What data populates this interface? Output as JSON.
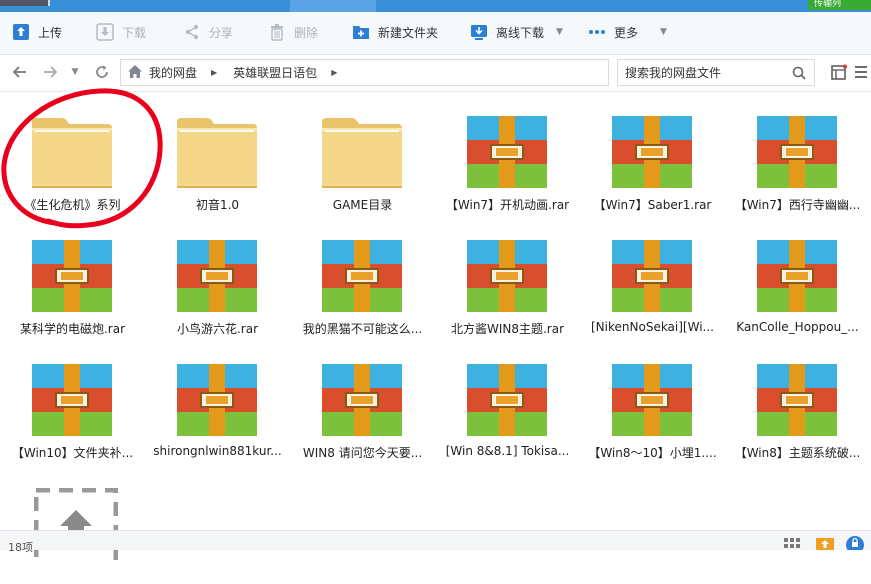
{
  "window": {
    "top_right_badge": "传输列"
  },
  "toolbar": {
    "upload": "上传",
    "download": "下载",
    "share": "分享",
    "delete": "删除",
    "new_folder": "新建文件夹",
    "offline_download": "离线下载",
    "more": "更多"
  },
  "nav": {
    "crumbs": [
      "我的网盘",
      "英雄联盟日语包"
    ],
    "search_placeholder": "搜索我的网盘文件"
  },
  "files": [
    {
      "name": "《生化危机》系列",
      "type": "folder"
    },
    {
      "name": "初音1.0",
      "type": "folder"
    },
    {
      "name": "GAME目录",
      "type": "folder"
    },
    {
      "name": "【Win7】开机动画.rar",
      "type": "rar"
    },
    {
      "name": "【Win7】Saber1.rar",
      "type": "rar"
    },
    {
      "name": "【Win7】西行寺幽幽...",
      "type": "rar"
    },
    {
      "name": "某科学的电磁炮.rar",
      "type": "rar"
    },
    {
      "name": "小鸟游六花.rar",
      "type": "rar"
    },
    {
      "name": "我的黑猫不可能这么...",
      "type": "rar"
    },
    {
      "name": "北方酱WIN8主题.rar",
      "type": "rar"
    },
    {
      "name": "[NikenNoSekai][Wi...",
      "type": "rar"
    },
    {
      "name": "KanColle_Hoppou_...",
      "type": "rar"
    },
    {
      "name": "【Win10】文件夹补...",
      "type": "rar"
    },
    {
      "name": "shirongnlwin881kur...",
      "type": "rar"
    },
    {
      "name": "WIN8 请问您今天要...",
      "type": "rar"
    },
    {
      "name": "[Win 8&8.1] Tokisa...",
      "type": "rar"
    },
    {
      "name": "【Win8～10】小埋1....",
      "type": "rar"
    },
    {
      "name": "【Win8】主题系统破...",
      "type": "rar"
    },
    {
      "name": "",
      "type": "upload"
    }
  ],
  "status": {
    "count": "18项"
  },
  "colors": {
    "accent": "#3a8fd9",
    "annotation": "#e8001c"
  }
}
